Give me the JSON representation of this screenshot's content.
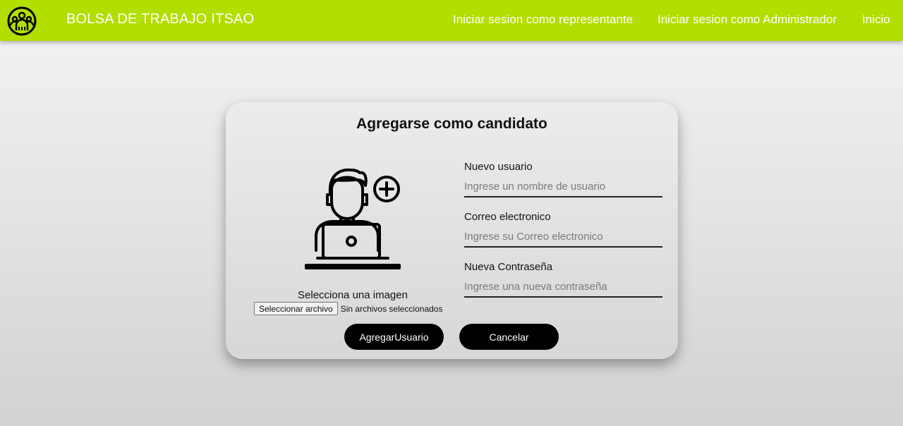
{
  "header": {
    "brand": "BOLSA DE TRABAJO ITSAO",
    "logo_icon": "people-group-icon",
    "nav": [
      {
        "label": "Iniciar sesion como representante"
      },
      {
        "label": "Iniciar sesion como Administrador"
      },
      {
        "label": "Inicio"
      }
    ]
  },
  "form": {
    "title": "Agregarse como candidato",
    "illustration_icon": "user-laptop-add-icon",
    "image_label": "Selecciona una imagen",
    "file_button": "Seleccionar archivo",
    "file_status": "Sin archivos seleccionados",
    "fields": [
      {
        "label": "Nuevo usuario",
        "placeholder": "Ingrese un nombre de usuario",
        "value": ""
      },
      {
        "label": "Correo electronico",
        "placeholder": "Ingrese su Correo electronico",
        "value": ""
      },
      {
        "label": "Nueva Contraseña",
        "placeholder": "Ingrese una nueva contraseña",
        "value": ""
      }
    ],
    "submit_label": "AgregarUsuario",
    "cancel_label": "Cancelar"
  },
  "colors": {
    "navbar": "#b2de00",
    "button": "#000000"
  }
}
